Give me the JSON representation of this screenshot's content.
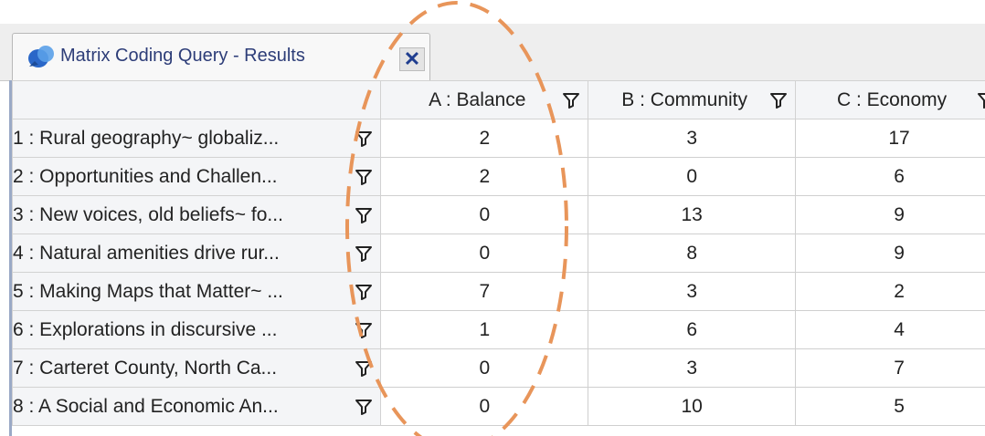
{
  "tab": {
    "title": "Matrix Coding Query - Results",
    "icon": "matrix-query-icon",
    "close_icon": "close-icon",
    "close_glyph": "✕"
  },
  "columns": [
    {
      "label": "A : Balance"
    },
    {
      "label": "B : Community"
    },
    {
      "label": "C : Economy"
    }
  ],
  "rows": [
    {
      "label": "1 : Rural geography~ globaliz...",
      "values": [
        "2",
        "3",
        "17"
      ]
    },
    {
      "label": "2 : Opportunities and Challen...",
      "values": [
        "2",
        "0",
        "6"
      ]
    },
    {
      "label": "3 : New voices, old beliefs~ fo...",
      "values": [
        "0",
        "13",
        "9"
      ]
    },
    {
      "label": "4 : Natural amenities drive rur...",
      "values": [
        "0",
        "8",
        "9"
      ]
    },
    {
      "label": "5 : Making Maps that Matter~ ...",
      "values": [
        "7",
        "3",
        "2"
      ]
    },
    {
      "label": "6 : Explorations in discursive ...",
      "values": [
        "1",
        "6",
        "4"
      ]
    },
    {
      "label": "7 : Carteret County, North Ca...",
      "values": [
        "0",
        "3",
        "7"
      ]
    },
    {
      "label": "8 : A Social and Economic An...",
      "values": [
        "0",
        "10",
        "5"
      ]
    }
  ],
  "colors": {
    "highlight": "#e8955a",
    "tab_text": "#2d3d78"
  }
}
